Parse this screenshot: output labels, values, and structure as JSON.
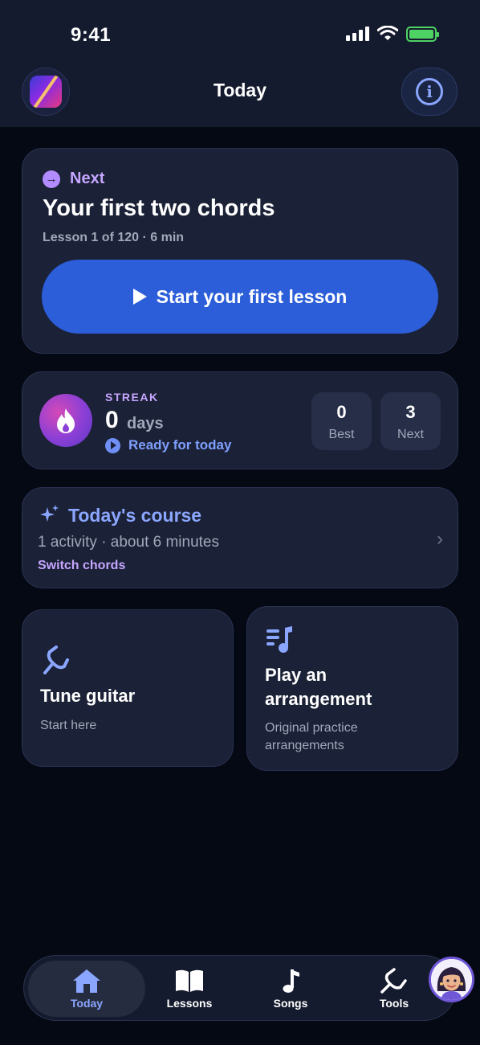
{
  "status_bar": {
    "time": "9:41"
  },
  "header": {
    "title": "Today"
  },
  "next_lesson": {
    "label": "Next",
    "title": "Your first two chords",
    "meta": "Lesson 1 of 120 · 6 min",
    "button_label": "Start your first lesson"
  },
  "streak": {
    "label": "STREAK",
    "count": "0",
    "unit": "days",
    "status": "Ready for today",
    "best_value": "0",
    "best_label": "Best",
    "next_value": "3",
    "next_label": "Next"
  },
  "course": {
    "title": "Today's course",
    "meta": "1 activity · about 6 minutes",
    "link": "Switch chords"
  },
  "tiles": [
    {
      "title": "Tune guitar",
      "subtitle": "Start here",
      "icon": "tuning-fork-icon"
    },
    {
      "title_line1": "Play an",
      "title_line2": "arrangement",
      "subtitle_line1": "Original practice",
      "subtitle_line2": "arrangements",
      "icon": "music-queue-icon"
    }
  ],
  "tabs": [
    {
      "label": "Today",
      "icon": "home-icon",
      "active": true
    },
    {
      "label": "Lessons",
      "icon": "book-icon",
      "active": false
    },
    {
      "label": "Songs",
      "icon": "music-note-icon",
      "active": false
    },
    {
      "label": "Tools",
      "icon": "tuning-fork-icon",
      "active": false
    }
  ],
  "colors": {
    "accent_blue": "#8aa6ff",
    "accent_purple": "#c6a6ff",
    "button_blue": "#2c5ed9",
    "card_bg": "#1b2136",
    "page_bg": "#050914"
  }
}
